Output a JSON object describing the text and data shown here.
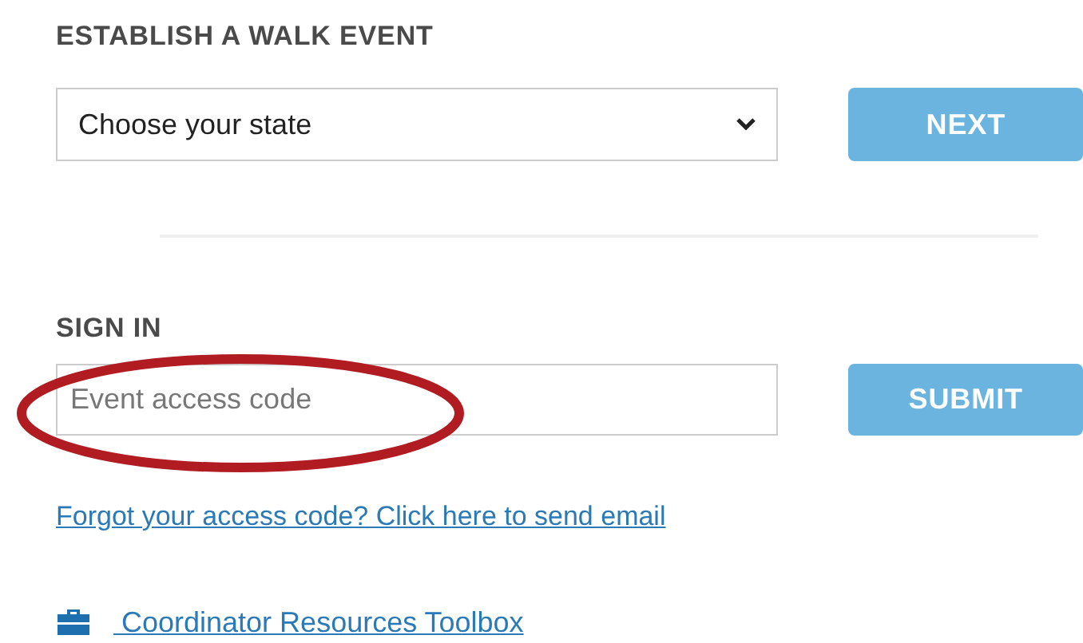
{
  "establish": {
    "heading": "ESTABLISH A WALK EVENT",
    "state_select": {
      "value": "Choose your state"
    },
    "button": "NEXT"
  },
  "sign_in": {
    "heading": "SIGN IN",
    "access_code": {
      "placeholder": "Event access code"
    },
    "button": "SUBMIT",
    "highlighted": true
  },
  "forgot_link": "Forgot your access code? Click here to send email",
  "toolbox_link": " Coordinator Resources Toolbox"
}
